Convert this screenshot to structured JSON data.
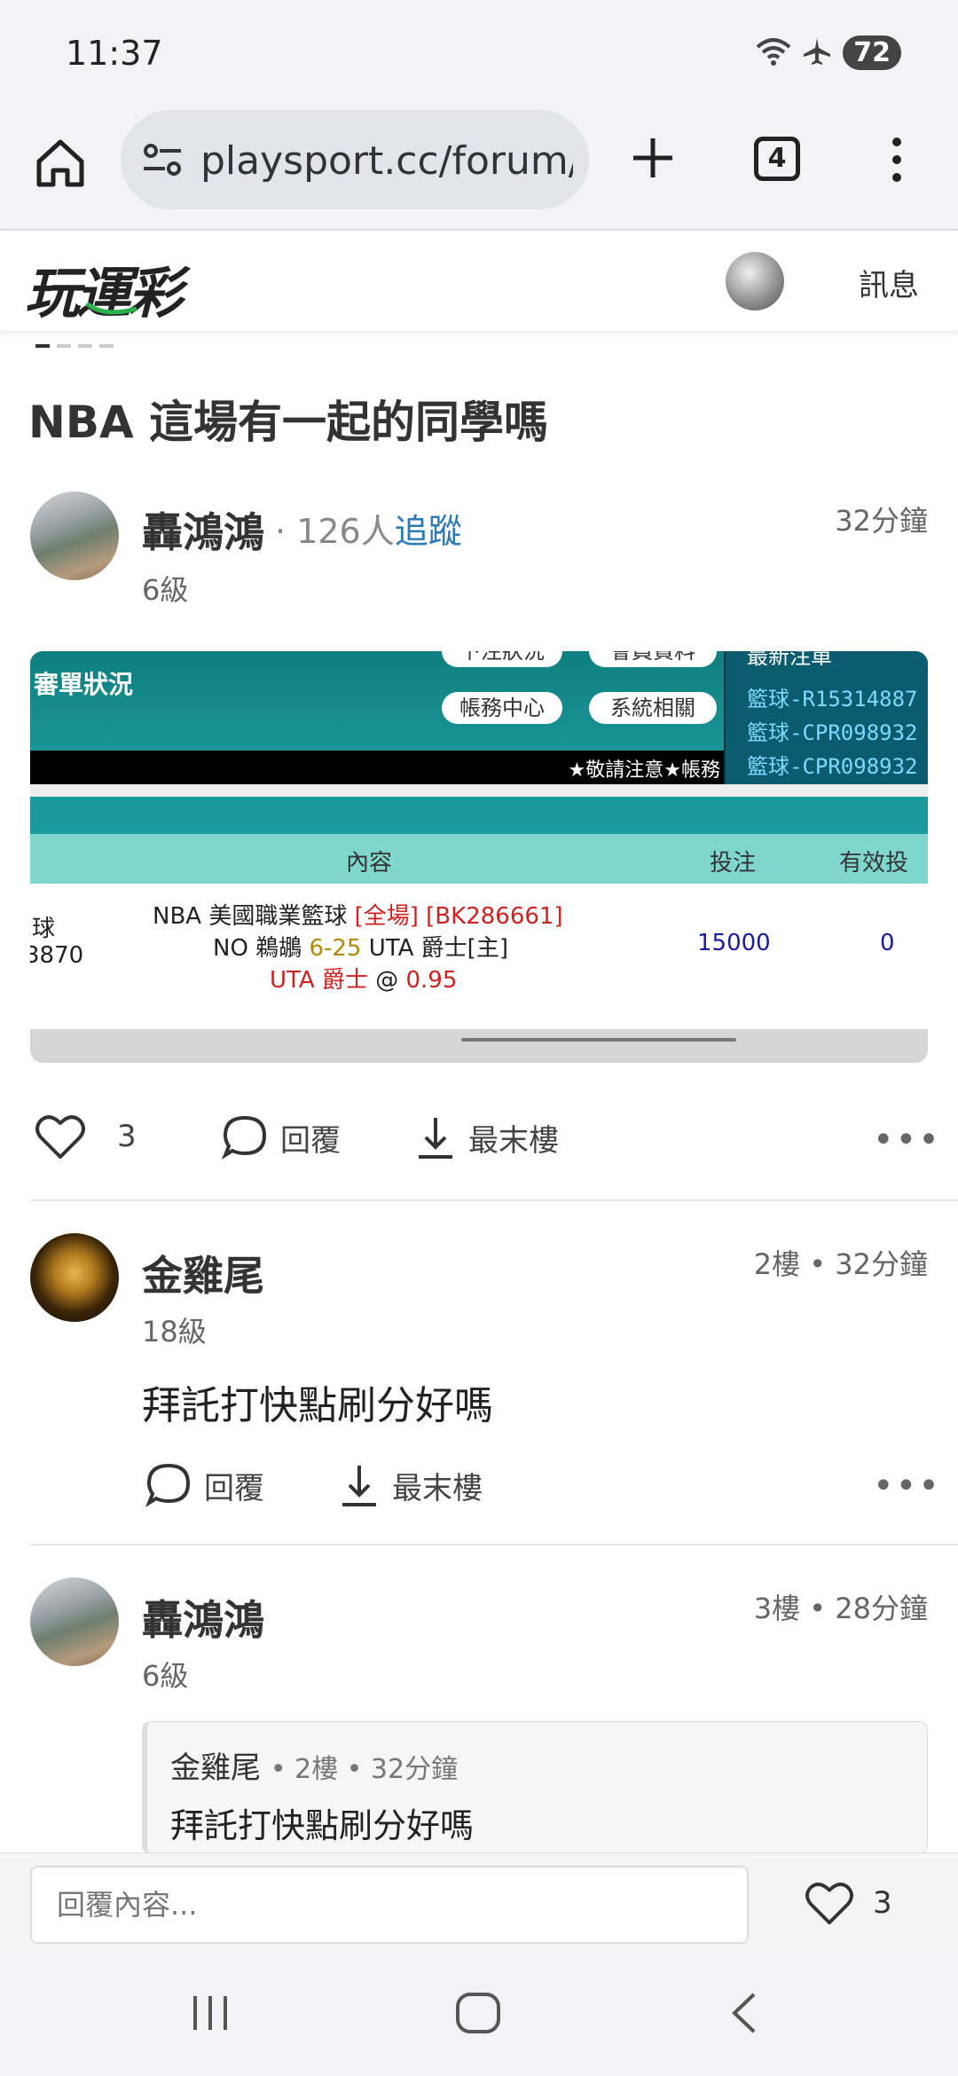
{
  "status": {
    "time": "11:37",
    "battery": "72"
  },
  "browser": {
    "url": "playsport.cc/forum/p",
    "tab_count": "4"
  },
  "site": {
    "logo": "玩運彩",
    "messages_label": "訊息"
  },
  "post": {
    "title": "NBA 這場有一起的同學嗎",
    "author": "轟鴻鴻",
    "followers_prefix": "·",
    "followers_count": "126人",
    "follow_label": "追蹤",
    "level": "6級",
    "time": "32分鐘",
    "likes": "3",
    "reply_label": "回覆",
    "last_floor_label": "最末樓"
  },
  "embed": {
    "title": "審單狀況",
    "top_pills": [
      "下注狀況",
      "會員資料"
    ],
    "pills": [
      "帳務中心",
      "系統相關"
    ],
    "side_top": "最新注單",
    "side_items": [
      "籃球-R15314887",
      "籃球-CPR098932",
      "籃球-CPR098932"
    ],
    "notice": "★敬請注意★帳務",
    "headers": {
      "content": "內容",
      "bet": "投注",
      "valid": "有效投注"
    },
    "row": {
      "left1": "球",
      "left2": "3870",
      "line1_a": "NBA 美國職業籃球",
      "line1_b": "[全場] [BK286661]",
      "line2_a": "NO 鵜鶘",
      "line2_b": "6-25",
      "line2_c": "UTA 爵士[主]",
      "line3_a": "UTA 爵士",
      "line3_b": "@",
      "line3_c": "0.95",
      "bet": "15000",
      "valid": "0"
    }
  },
  "comments": [
    {
      "author": "金雞尾",
      "level": "18級",
      "meta": "2樓 • 32分鐘",
      "text": "拜託打快點刷分好嗎",
      "reply_label": "回覆",
      "last_floor_label": "最末樓"
    },
    {
      "author": "轟鴻鴻",
      "level": "6級",
      "meta": "3樓 • 28分鐘",
      "quote_author": "金雞尾",
      "quote_meta": "• 2樓 • 32分鐘",
      "quote_text": "拜託打快點刷分好嗎"
    }
  ],
  "reply_bar": {
    "placeholder": "回覆內容...",
    "likes": "3"
  },
  "more_label": "•••"
}
